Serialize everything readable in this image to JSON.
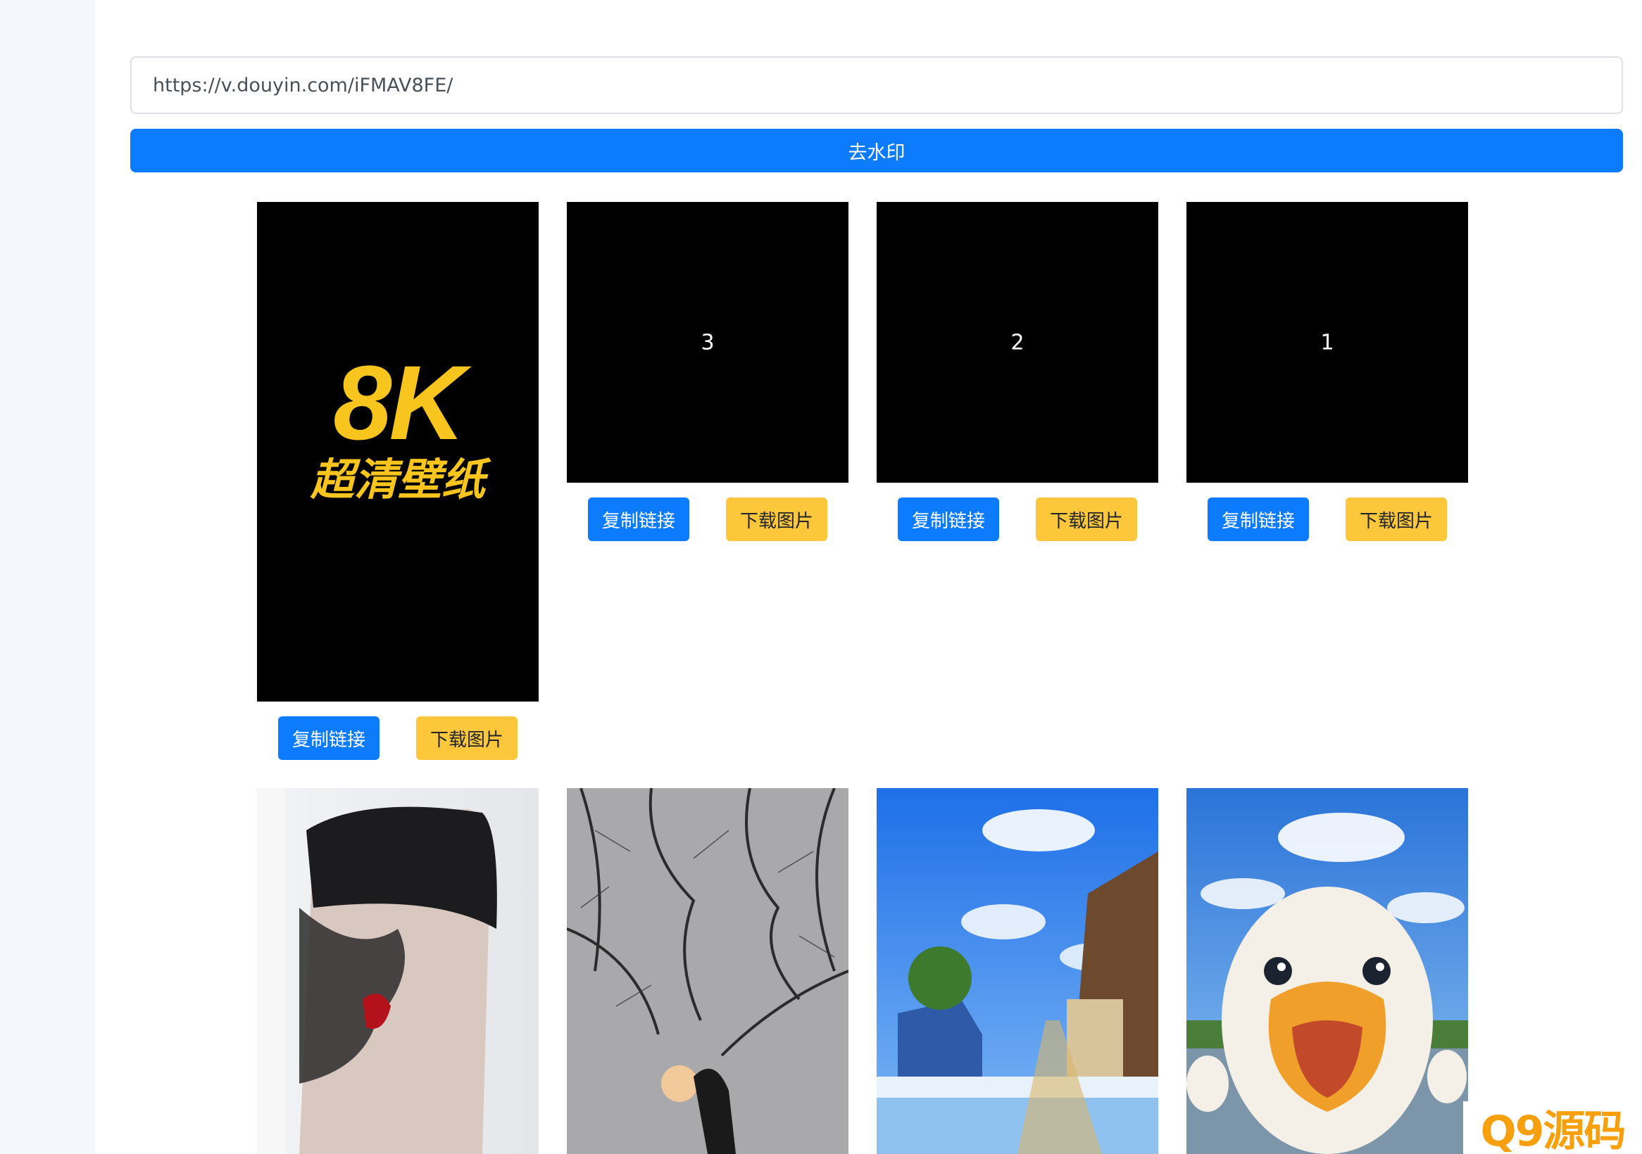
{
  "form": {
    "url_value": "https://v.douyin.com/iFMAV8FE/",
    "submit_label": "去水印"
  },
  "cover": {
    "headline": "8K",
    "subline": "超清壁纸"
  },
  "tiles": [
    {
      "number": "3"
    },
    {
      "number": "2"
    },
    {
      "number": "1"
    }
  ],
  "actions": {
    "copy_label": "复制链接",
    "download_label": "下载图片"
  },
  "watermark": {
    "text": "Q9源码"
  },
  "colors": {
    "primary": "#0d7bfd",
    "warning": "#fdc73b",
    "rail": "#f4f6fb"
  }
}
